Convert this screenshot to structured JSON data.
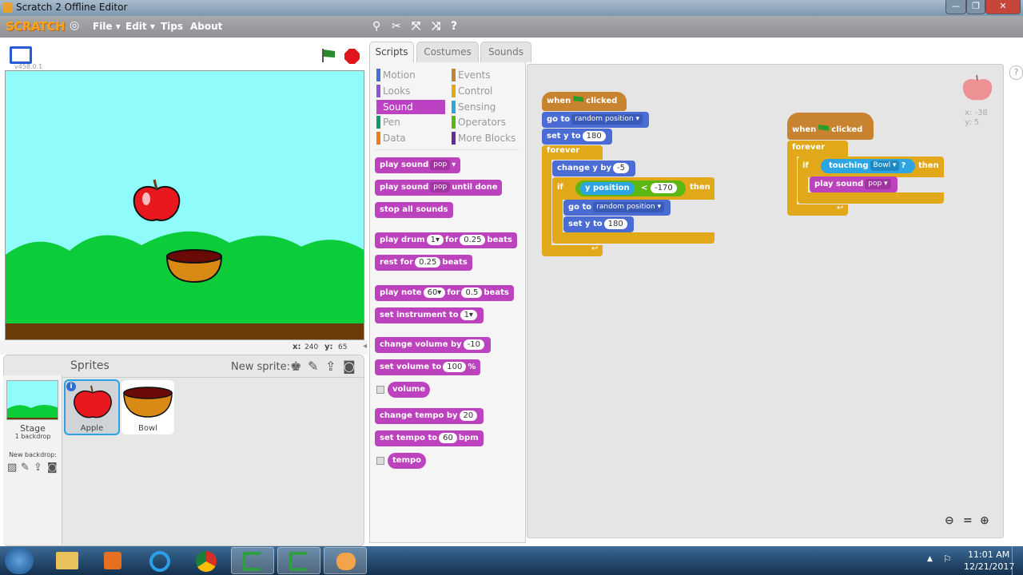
{
  "window": {
    "title": "Scratch 2 Offline Editor"
  },
  "menu": {
    "logo": "SCRATCH",
    "file": "File ▾",
    "edit": "Edit ▾",
    "tips": "Tips",
    "about": "About"
  },
  "stage": {
    "version": "v458.0.1",
    "x_label": "x:",
    "x_value": "240",
    "y_label": "y:",
    "y_value": "65"
  },
  "sprites": {
    "header": "Sprites",
    "new_sprite": "New sprite:",
    "stage_label": "Stage",
    "backdrops": "1 backdrop",
    "new_backdrop": "New backdrop:",
    "items": [
      {
        "name": "Apple"
      },
      {
        "name": "Bowl"
      }
    ]
  },
  "tabs": [
    "Scripts",
    "Costumes",
    "Sounds"
  ],
  "categories": {
    "left": [
      "Motion",
      "Looks",
      "Sound",
      "Pen",
      "Data"
    ],
    "right": [
      "Events",
      "Control",
      "Sensing",
      "Operators",
      "More Blocks"
    ],
    "colors": {
      "Motion": "#4a6cd4",
      "Looks": "#8a55d7",
      "Sound": "#bb42c3",
      "Pen": "#0e9a6c",
      "Data": "#ee7d16",
      "Events": "#c88330",
      "Control": "#e1a91a",
      "Sensing": "#2ca5e2",
      "Operators": "#5cb712",
      "More Blocks": "#632d99"
    }
  },
  "palette": {
    "play_sound": "play sound",
    "pop": "pop",
    "until_done": "until done",
    "stop_all": "stop all sounds",
    "play_drum": "play drum",
    "drum_val": "1▾",
    "for": "for",
    "drum_beats": "0.25",
    "beats": "beats",
    "rest_for": "rest for",
    "rest_val": "0.25",
    "play_note": "play note",
    "note_val": "60▾",
    "note_beats": "0.5",
    "set_instrument": "set instrument to",
    "instrument_val": "1▾",
    "change_volume": "change volume by",
    "change_volume_val": "-10",
    "set_volume": "set volume to",
    "volume_val": "100",
    "percent": "%",
    "volume": "volume",
    "change_tempo": "change tempo by",
    "tempo_change_val": "20",
    "set_tempo": "set tempo to",
    "tempo_val": "60",
    "bpm": "bpm",
    "tempo": "tempo"
  },
  "script1": {
    "when": "when",
    "clicked": "clicked",
    "go_to": "go to",
    "random_position": "random position ▾",
    "set_y_to": "set y to",
    "y_180": "180",
    "forever": "forever",
    "change_y_by": "change y by",
    "y_change": "-5",
    "if": "if",
    "y_position": "y position",
    "lt": "<",
    "limit": "-170",
    "then": "then"
  },
  "script2": {
    "when": "when",
    "clicked": "clicked",
    "forever": "forever",
    "if": "if",
    "touching": "touching",
    "bowl": "Bowl ▾",
    "q": "?",
    "then": "then",
    "play_sound": "play sound",
    "pop": "pop ▾"
  },
  "sprite_info": {
    "x": "x: -38",
    "y": "y: 5"
  },
  "taskbar": {
    "time": "11:01 AM",
    "date": "12/21/2017"
  }
}
